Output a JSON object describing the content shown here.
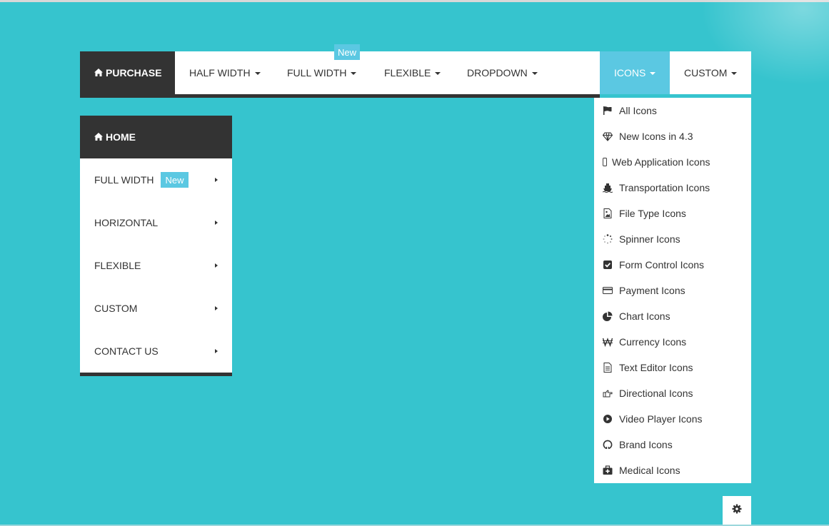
{
  "colors": {
    "background": "#36c4ce",
    "dark": "#333333",
    "accent": "#5bc8e2"
  },
  "topnav": {
    "purchase_label": "PURCHASE",
    "half_width_label": "HALF WIDTH",
    "full_width_label": "FULL WIDTH",
    "new_badge": "New",
    "flexible_label": "FLEXIBLE",
    "dropdown_label": "DROPDOWN",
    "icons_label": "ICONS",
    "custom_label": "CUSTOM"
  },
  "sidebar": {
    "home_label": "HOME",
    "items": [
      {
        "label": "FULL WIDTH",
        "badge": "New"
      },
      {
        "label": "HORIZONTAL"
      },
      {
        "label": "FLEXIBLE"
      },
      {
        "label": "CUSTOM"
      },
      {
        "label": "CONTACT US"
      }
    ]
  },
  "icons_menu": {
    "items": [
      {
        "label": "All Icons",
        "icon": "flag-icon"
      },
      {
        "label": "New Icons in 4.3",
        "icon": "diamond-icon"
      },
      {
        "label": "Web Application Icons",
        "icon": "mobile-icon"
      },
      {
        "label": "Transportation Icons",
        "icon": "ship-icon"
      },
      {
        "label": "File Type Icons",
        "icon": "file-image-icon"
      },
      {
        "label": "Spinner Icons",
        "icon": "spinner-icon"
      },
      {
        "label": "Form Control Icons",
        "icon": "check-square-icon"
      },
      {
        "label": "Payment Icons",
        "icon": "credit-card-icon"
      },
      {
        "label": "Chart Icons",
        "icon": "pie-chart-icon"
      },
      {
        "label": "Currency Icons",
        "icon": "won-icon"
      },
      {
        "label": "Text Editor Icons",
        "icon": "file-text-icon"
      },
      {
        "label": "Directional Icons",
        "icon": "hand-point-right-icon"
      },
      {
        "label": "Video Player Icons",
        "icon": "play-circle-icon"
      },
      {
        "label": "Brand Icons",
        "icon": "github-icon"
      },
      {
        "label": "Medical Icons",
        "icon": "medkit-icon"
      }
    ]
  },
  "settings": {
    "icon": "gear-icon"
  }
}
